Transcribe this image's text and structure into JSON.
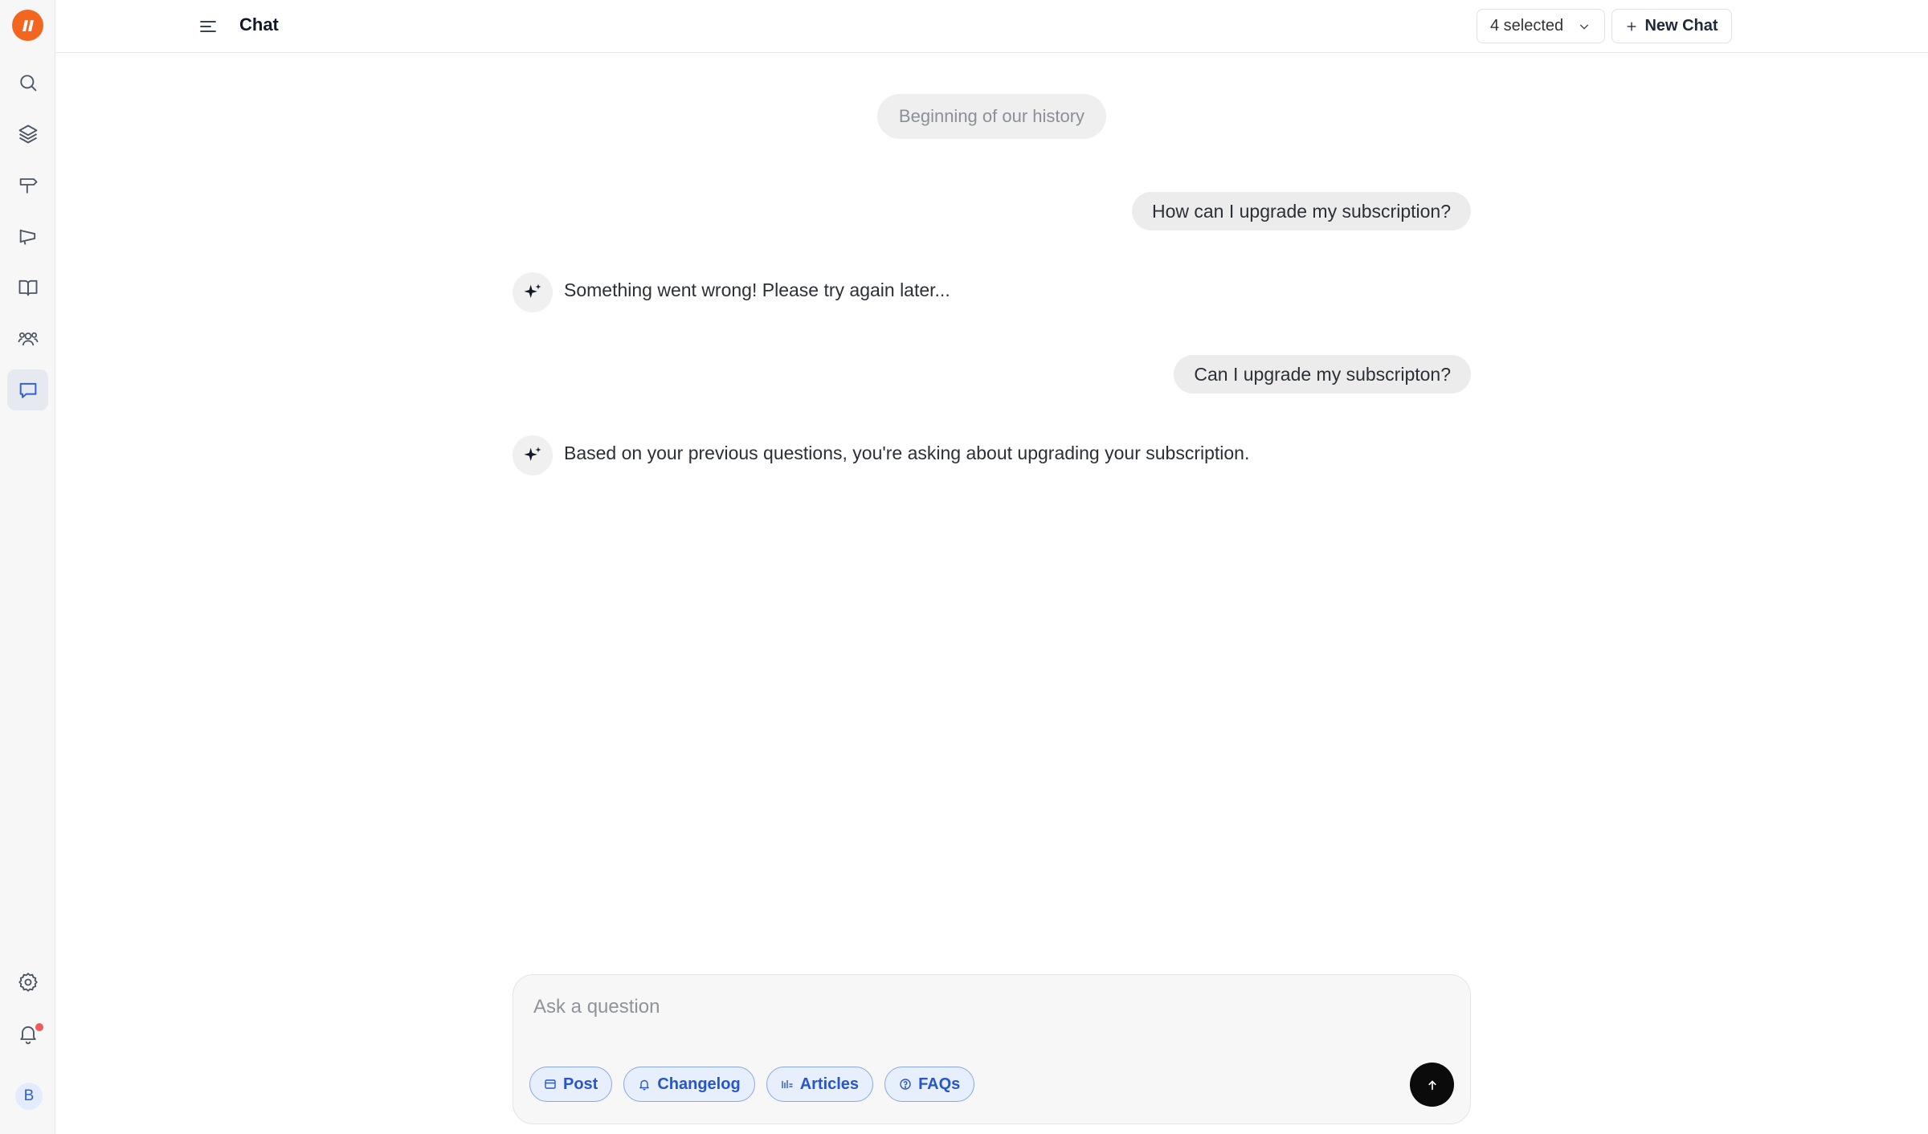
{
  "app": {
    "logo_icon": "product-logo-icon",
    "accent_color": "#f2661f"
  },
  "sidebar": {
    "items": [
      {
        "id": "search",
        "icon": "search-icon",
        "active": false
      },
      {
        "id": "layers",
        "icon": "layers-icon",
        "active": false
      },
      {
        "id": "roadmap",
        "icon": "signpost-icon",
        "active": false
      },
      {
        "id": "announcements",
        "icon": "megaphone-icon",
        "active": false
      },
      {
        "id": "knowledge-base",
        "icon": "book-icon",
        "active": false
      },
      {
        "id": "users",
        "icon": "users-icon",
        "active": false
      },
      {
        "id": "chat",
        "icon": "chat-icon",
        "active": true
      }
    ],
    "bottom": [
      {
        "id": "settings",
        "icon": "gear-icon"
      },
      {
        "id": "notifications",
        "icon": "bell-icon",
        "has_unread": true
      }
    ],
    "avatar_initial": "B"
  },
  "header": {
    "menu_icon": "menu-icon",
    "title": "Chat",
    "selector_label": "4 selected",
    "new_chat_label": "New Chat"
  },
  "chat": {
    "history_label": "Beginning of our history",
    "messages": [
      {
        "role": "user",
        "text": "How can I upgrade my subscription?"
      },
      {
        "role": "assistant",
        "text": "Something went wrong! Please try again later..."
      },
      {
        "role": "user",
        "text": "Can I upgrade my subscripton?"
      },
      {
        "role": "assistant",
        "text": "Based on your previous questions, you're asking about upgrading your subscription."
      }
    ]
  },
  "composer": {
    "placeholder": "Ask a question",
    "value": "",
    "chips": [
      {
        "label": "Post",
        "icon": "post-icon"
      },
      {
        "label": "Changelog",
        "icon": "bell-icon"
      },
      {
        "label": "Articles",
        "icon": "articles-icon"
      },
      {
        "label": "FAQs",
        "icon": "question-circle-icon"
      }
    ],
    "send_icon": "arrow-up-icon"
  }
}
